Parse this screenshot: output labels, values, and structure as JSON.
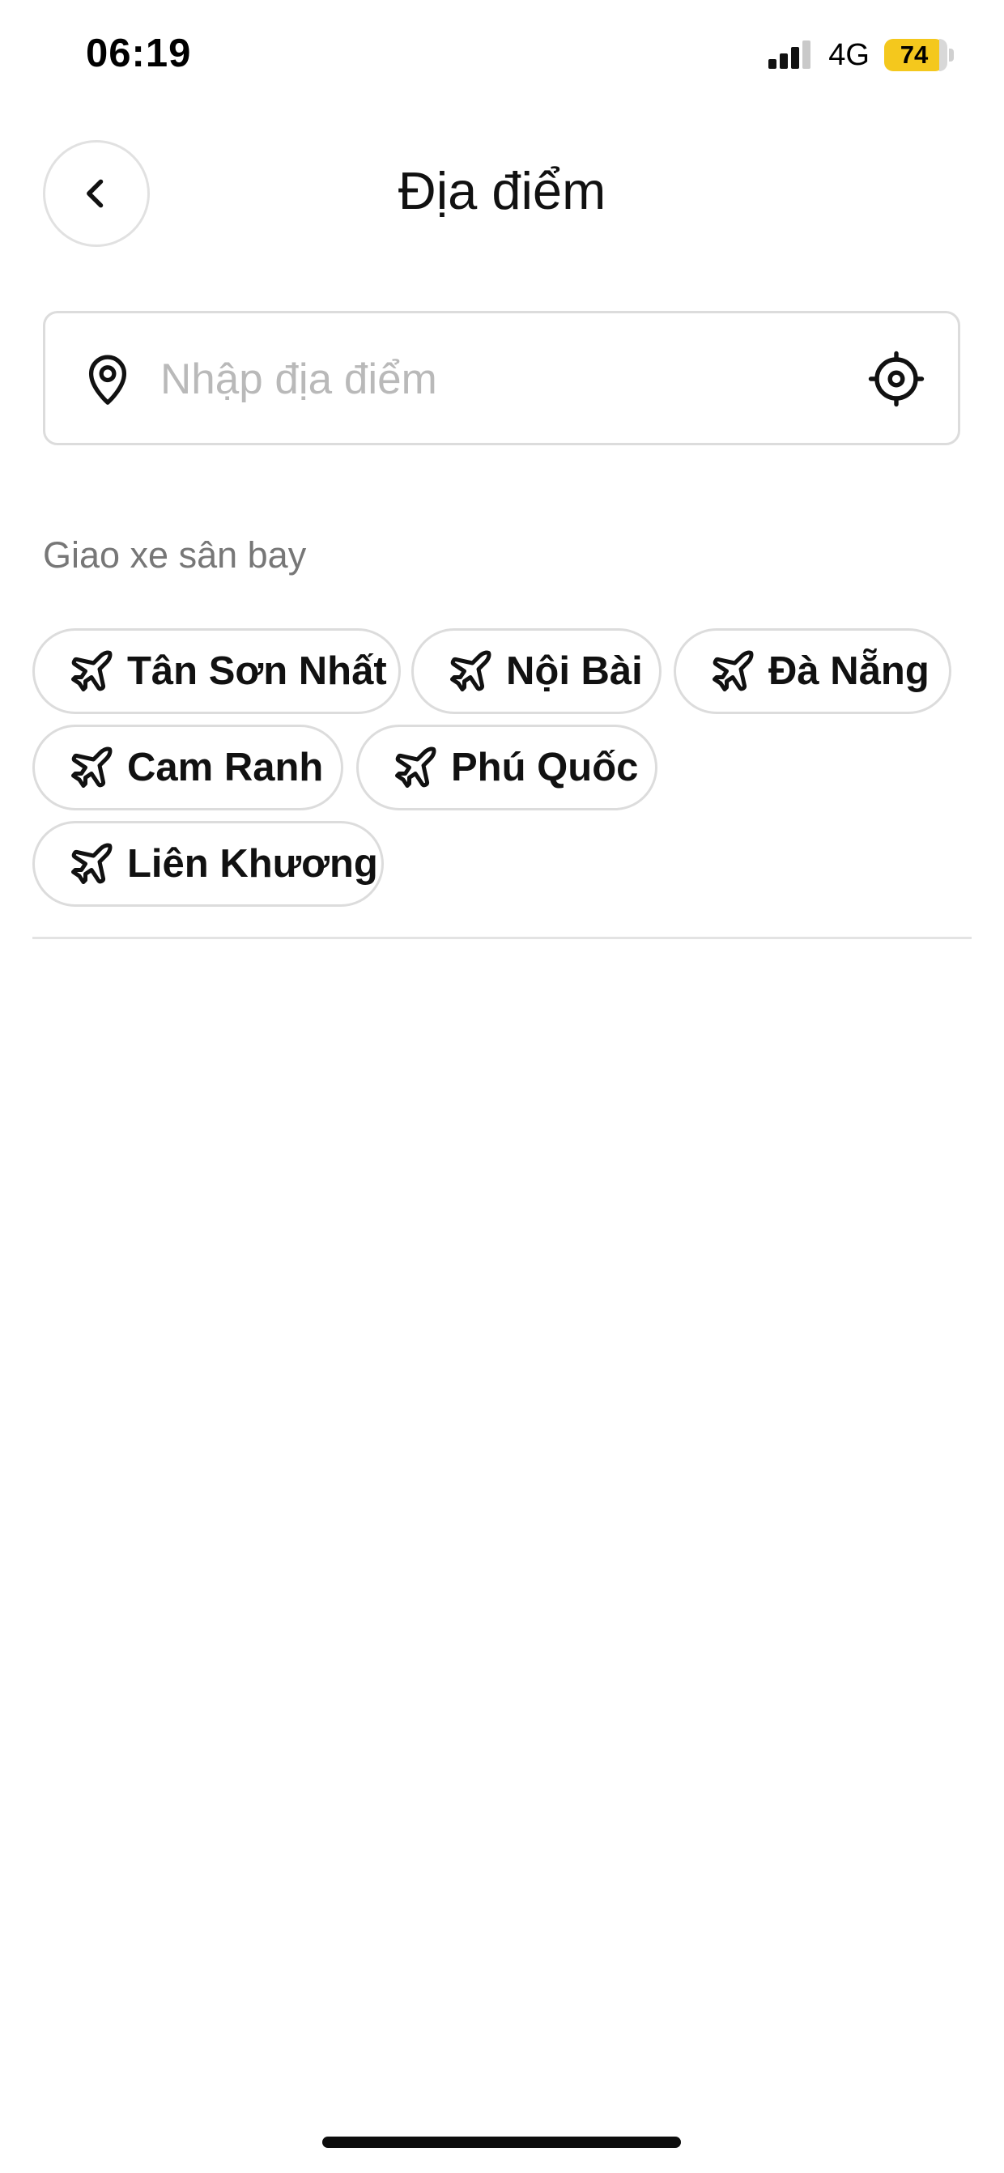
{
  "status_bar": {
    "time": "06:19",
    "network": "4G",
    "battery": "74",
    "battery_color": "#f4c81d"
  },
  "header": {
    "title": "Địa điểm",
    "back_icon": "chevron-left-icon"
  },
  "search": {
    "value": "",
    "placeholder": "Nhập địa điểm",
    "leading_icon": "map-pin-icon",
    "trailing_icon": "locate-crosshair-icon"
  },
  "airport_section": {
    "title": "Giao xe sân bay",
    "icon": "airplane-icon",
    "airports": [
      {
        "label": "Tân Sơn Nhất"
      },
      {
        "label": "Nội Bài"
      },
      {
        "label": "Đà Nẵng"
      },
      {
        "label": "Cam Ranh"
      },
      {
        "label": "Phú Quốc"
      },
      {
        "label": "Liên Khương"
      }
    ]
  }
}
